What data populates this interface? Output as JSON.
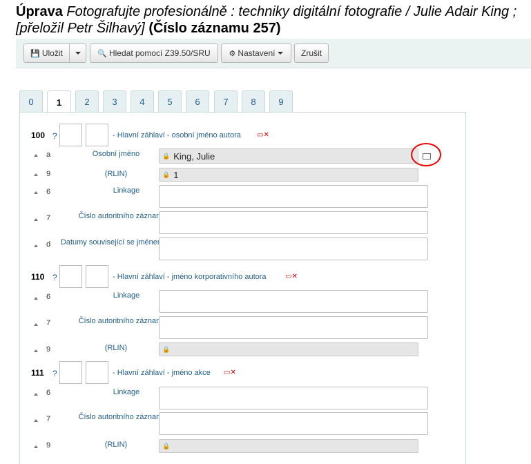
{
  "header": {
    "title_bold": "Úprava",
    "title_italic": "Fotografujte profesionálně : techniky digitální fotografie / Julie Adair King ; [přeložil Petr Šilhavý]",
    "title_record": "(Číslo záznamu 257)"
  },
  "toolbar": {
    "save_label": "Uložit",
    "search_label": "Hledat pomocí Z39.50/SRU",
    "settings_label": "Nastavení",
    "cancel_label": "Zrušit"
  },
  "tabs": [
    "0",
    "1",
    "2",
    "3",
    "4",
    "5",
    "6",
    "7",
    "8",
    "9"
  ],
  "active_tab": "1",
  "fields": {
    "f100": {
      "tag": "100",
      "help": "?",
      "label": "- Hlavní záhlaví - osobní jméno autora",
      "subs": [
        {
          "code": "a",
          "label": "Osobní jméno",
          "value": "King, Julie"
        },
        {
          "code": "9",
          "label": "(RLIN)",
          "value": "1"
        },
        {
          "code": "6",
          "label": "Linkage",
          "value": ""
        },
        {
          "code": "7",
          "label": "Číslo autoritního záznamu",
          "value": ""
        },
        {
          "code": "d",
          "label": "Datumy související se jménem",
          "value": ""
        }
      ]
    },
    "f110": {
      "tag": "110",
      "help": "?",
      "label": "- Hlavní záhlaví - jméno korporativního autora",
      "subs": [
        {
          "code": "6",
          "label": "Linkage",
          "value": ""
        },
        {
          "code": "7",
          "label": "Číslo autoritního záznamu",
          "value": ""
        },
        {
          "code": "9",
          "label": "(RLIN)",
          "value": ""
        }
      ]
    },
    "f111": {
      "tag": "111",
      "help": "?",
      "label": "- Hlavní záhlaví - jméno akce",
      "subs": [
        {
          "code": "6",
          "label": "Linkage",
          "value": ""
        },
        {
          "code": "7",
          "label": "Číslo autoritního záznamu",
          "value": ""
        },
        {
          "code": "9",
          "label": "(RLIN)",
          "value": ""
        }
      ]
    }
  },
  "icons": {
    "save": "floppy-icon",
    "search": "search-icon",
    "settings": "gear-icon",
    "remove": "delete-field-icon",
    "lock": "lock-icon",
    "edit": "authority-edit-icon"
  },
  "colors": {
    "link": "#1f5d8a",
    "highlight": "#e00000"
  }
}
